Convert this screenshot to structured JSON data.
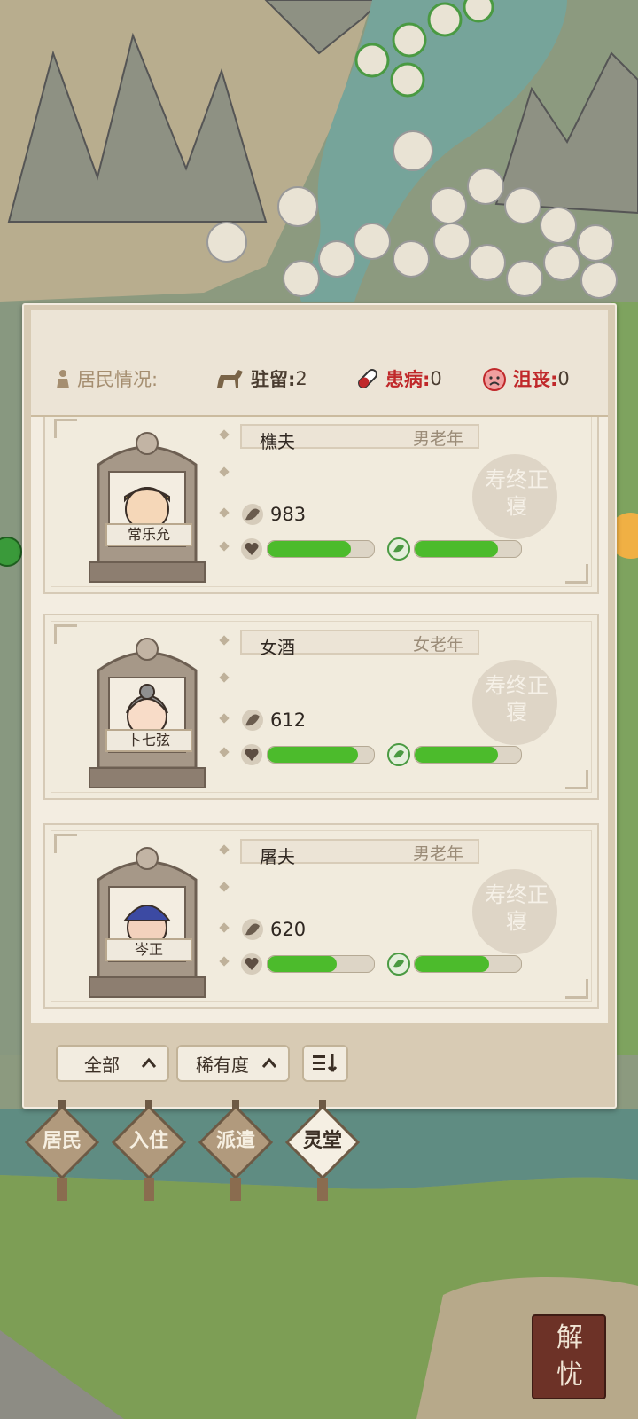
{
  "header": {
    "residents_label": "居民情况:",
    "stay_label": "驻留:",
    "stay_count": "2",
    "sick_label": "患病:",
    "sick_count": "0",
    "sad_label": "沮丧:",
    "sad_count": "0"
  },
  "residents": [
    {
      "name": "常乐允",
      "job": "樵夫",
      "age_group": "男老年",
      "value": "983",
      "health": 0.78,
      "mood": 0.78,
      "stamp": "寿终正寝"
    },
    {
      "name": "卜七弦",
      "job": "女酒",
      "age_group": "女老年",
      "value": "612",
      "health": 0.85,
      "mood": 0.78,
      "stamp": "寿终正寝"
    },
    {
      "name": "岑正",
      "job": "屠夫",
      "age_group": "男老年",
      "value": "620",
      "health": 0.65,
      "mood": 0.7,
      "stamp": "寿终正寝"
    }
  ],
  "filters": {
    "all_label": "全部",
    "rarity_label": "稀有度",
    "sort_icon": "sort-icon"
  },
  "tabs": [
    {
      "label": "居民",
      "active": false
    },
    {
      "label": "入住",
      "active": false
    },
    {
      "label": "派遣",
      "active": false
    },
    {
      "label": "灵堂",
      "active": true
    }
  ],
  "unlock_button": {
    "line1": "解",
    "line2": "忧"
  },
  "colors": {
    "bar_fill": "#4cbb2c",
    "red_text": "#c0282a",
    "panel_bg": "#d8cbb4"
  }
}
